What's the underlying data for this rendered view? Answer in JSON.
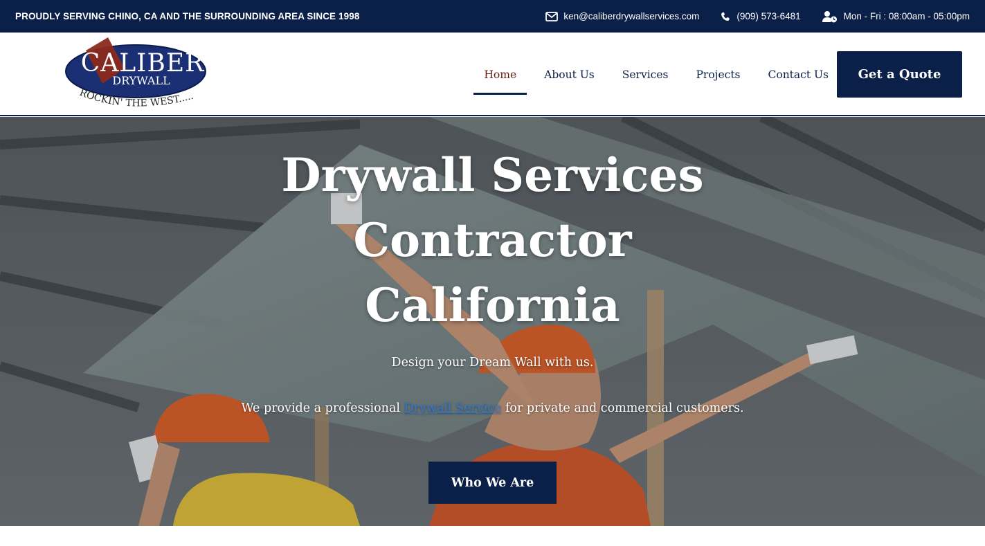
{
  "topbar": {
    "tagline": "PROUDLY SERVING CHINO, CA AND THE SURROUNDING AREA SINCE 1998",
    "email": "ken@caliberdrywallservices.com",
    "phone": "(909) 573-6481",
    "hours": "Mon - Fri : 08:00am - 05:00pm",
    "icons": [
      "envelope-icon",
      "phone-icon",
      "user-clock-icon"
    ]
  },
  "logo": {
    "line1": "CALIBER",
    "line2": "DRYWALL",
    "slogan": "ROCKIN' THE WEST....."
  },
  "nav": {
    "items": [
      "Home",
      "About Us",
      "Services",
      "Projects",
      "Contact Us"
    ],
    "active": "Home",
    "cta": "Get a Quote"
  },
  "hero": {
    "title_line1": "Drywall Services",
    "title_line2": "Contractor",
    "title_line3": "California",
    "subtitle": "Design your Dream Wall with us.",
    "text_before_link": "We provide a professional ",
    "link_text": "Drywall Service",
    "text_after_link": " for private and commercial customers.",
    "button": "Who We Are"
  },
  "colors": {
    "brand_navy": "#0b2048",
    "logo_red": "#8a2a1c",
    "active_nav": "#6a1e14",
    "link_blue": "#2f7ad1",
    "helmet_orange": "#e0622a"
  }
}
